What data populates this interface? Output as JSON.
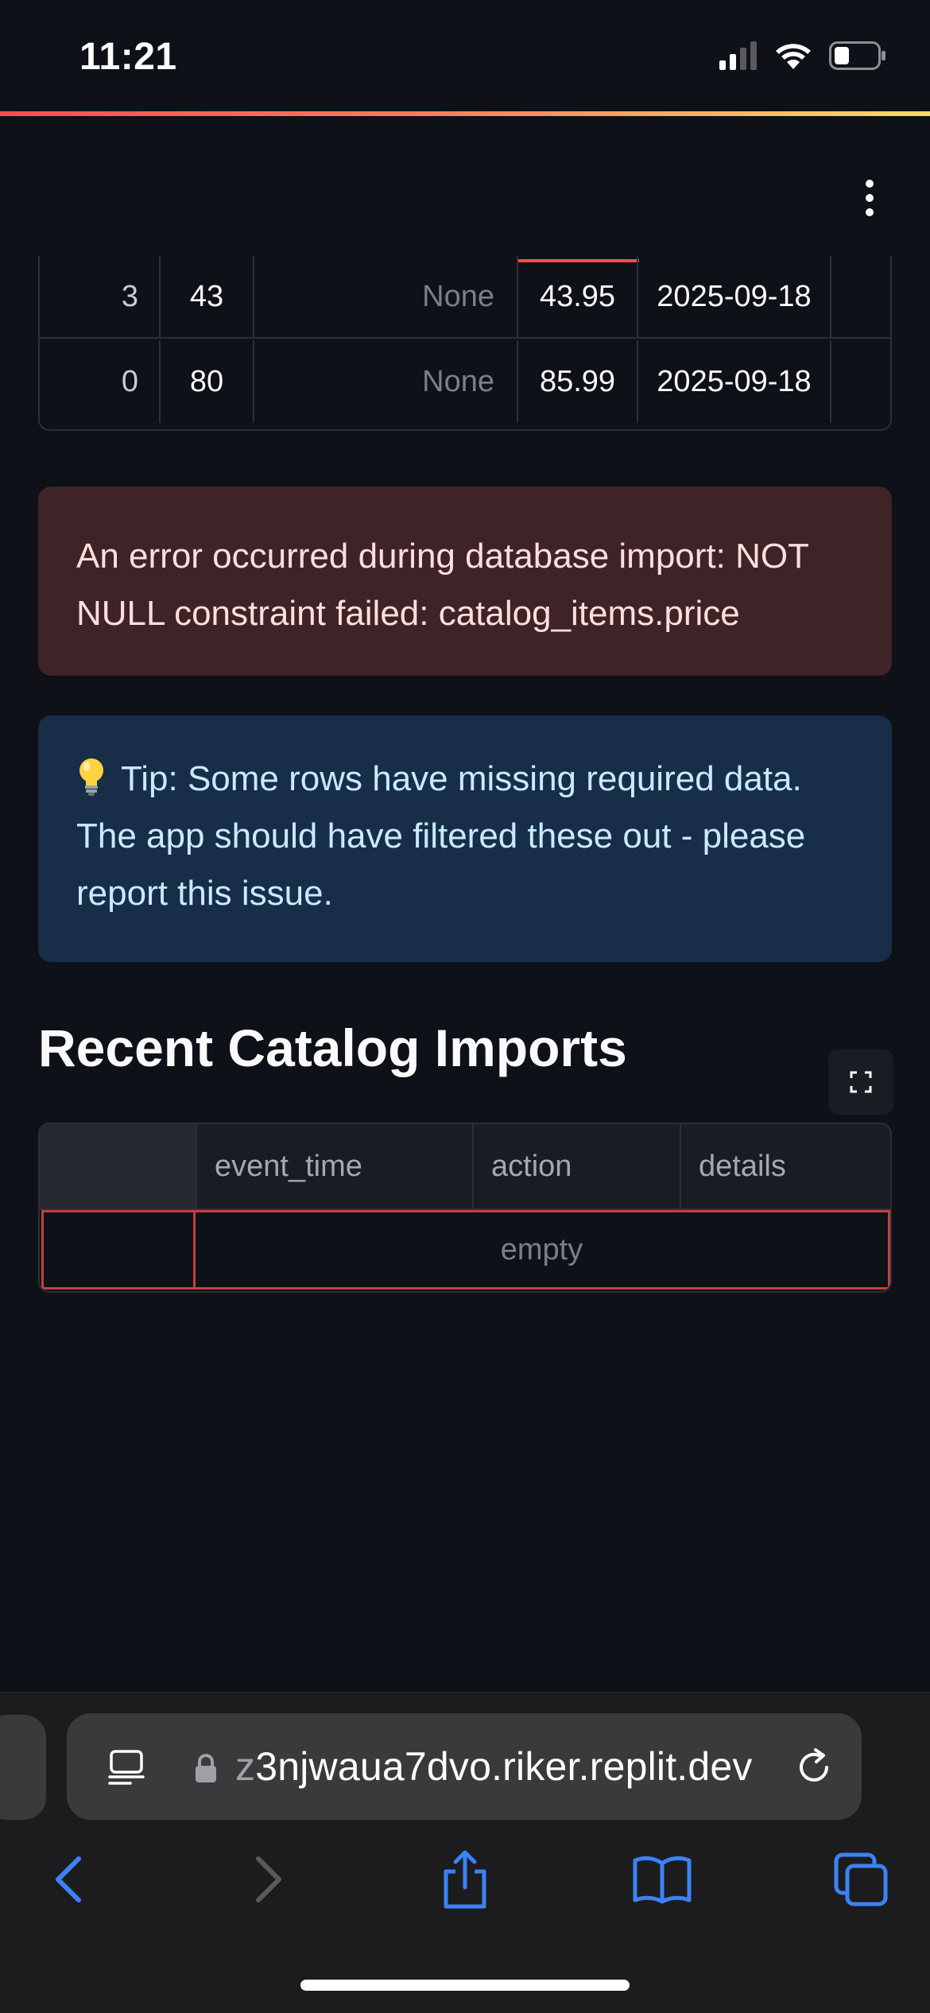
{
  "status_bar": {
    "time": "11:21",
    "icons": [
      "cellular-signal-icon",
      "wifi-icon",
      "battery-icon"
    ]
  },
  "app": {
    "menu_icon": "kebab-menu-icon",
    "accent_gradient": [
      "#ff4b4b",
      "#ffd966"
    ]
  },
  "top_table": {
    "rows": [
      {
        "index": "3",
        "col_a": "43",
        "col_b": "None",
        "price": "43.95",
        "date": "2025-09-18"
      },
      {
        "index": "0",
        "col_a": "80",
        "col_b": "None",
        "price": "85.99",
        "date": "2025-09-18"
      }
    ]
  },
  "error_alert": {
    "text": "An error occurred during database import: NOT NULL constraint failed: catalog_items.price",
    "color": "#3e2327"
  },
  "info_alert": {
    "icon": "lightbulb-icon",
    "text": "Tip: Some rows have missing required data. The app should have filtered these out - please report this issue.",
    "color": "#172d48"
  },
  "recent_imports": {
    "title": "Recent Catalog Imports",
    "fullscreen_icon": "fullscreen-icon",
    "columns": [
      "event_time",
      "action",
      "details"
    ],
    "empty_text": "empty"
  },
  "browser": {
    "url_prefix": "z",
    "url_rest": "3njwaua7dvo.riker.replit.dev",
    "nav_icons": [
      "back-icon",
      "forward-icon",
      "share-icon",
      "bookmarks-icon",
      "tabs-icon"
    ]
  }
}
